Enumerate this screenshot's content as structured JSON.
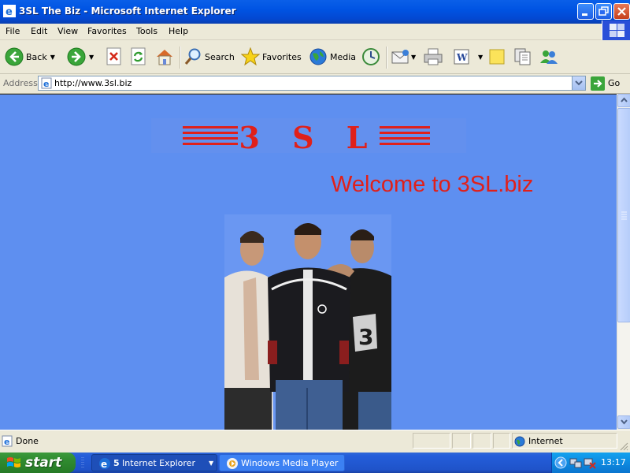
{
  "window": {
    "title": "3SL The Biz - Microsoft Internet Explorer"
  },
  "menu": [
    "File",
    "Edit",
    "View",
    "Favorites",
    "Tools",
    "Help"
  ],
  "toolbar": {
    "back_label": "Back",
    "search_label": "Search",
    "favorites_label": "Favorites",
    "media_label": "Media"
  },
  "address": {
    "label": "Address",
    "url": "http://www.3sl.biz",
    "go_label": "Go"
  },
  "page": {
    "logo_text": "3 S L",
    "welcome": "Welcome to 3SL.biz"
  },
  "status": {
    "text": "Done",
    "zone": "Internet"
  },
  "taskbar": {
    "start_label": "start",
    "tasks": [
      {
        "count": "5",
        "label": "Internet Explorer"
      },
      {
        "label": "Windows Media Player"
      }
    ],
    "clock": "13:17"
  },
  "colors": {
    "page_background": "#5e8ff0",
    "logo_red": "#e0201a",
    "title_bar": "#0054e3"
  }
}
